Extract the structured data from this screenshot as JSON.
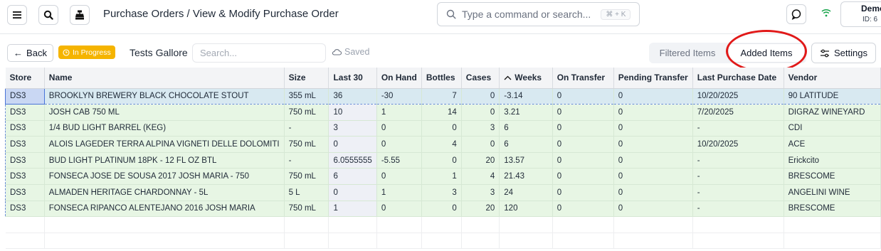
{
  "header": {
    "title": "Purchase Orders / View & Modify Purchase Order",
    "command_placeholder": "Type a command or search...",
    "command_shortcut": "⌘ + K",
    "user_name": "Demo",
    "user_id": "ID: 6"
  },
  "toolbar": {
    "back_label": "Back",
    "status": "In Progress",
    "po_name": "Tests Gallore",
    "search_placeholder": "Search...",
    "saved_label": "Saved",
    "filtered_label": "Filtered Items",
    "added_label": "Added Items",
    "settings_label": "Settings"
  },
  "colors": {
    "status_badge": "#f5b400",
    "row_green": "#e7f6e4",
    "selection_blue": "#4a74d8",
    "annotation_red": "#e11919"
  },
  "table": {
    "columns": [
      "Store",
      "Name",
      "Size",
      "Last 30",
      "On Hand",
      "Bottles",
      "Cases",
      "Weeks",
      "On Transfer",
      "Pending Transfer",
      "Last Purchase Date",
      "Vendor"
    ],
    "rows": [
      [
        "DS3",
        "BROOKLYN BREWERY BLACK CHOCOLATE STOUT",
        "355 mL",
        "36",
        "-30",
        "7",
        "0",
        "-3.14",
        "0",
        "0",
        "10/20/2025",
        "90 LATITUDE"
      ],
      [
        "DS3",
        "JOSH CAB 750 ML",
        "750 mL",
        "10",
        "1",
        "14",
        "0",
        "3.21",
        "0",
        "0",
        "7/20/2025",
        "DIGRAZ WINEYARD"
      ],
      [
        "DS3",
        "1/4 BUD LIGHT BARREL (KEG)",
        "-",
        "3",
        "0",
        "0",
        "3",
        "6",
        "0",
        "0",
        "-",
        "CDI"
      ],
      [
        "DS3",
        "ALOIS LAGEDER TERRA ALPINA VIGNETI DELLE DOLOMITI",
        "750 mL",
        "0",
        "0",
        "4",
        "0",
        "6",
        "0",
        "0",
        "10/20/2025",
        "ACE"
      ],
      [
        "DS3",
        "BUD LIGHT PLATINUM 18PK - 12 FL OZ BTL",
        "-",
        "6.0555555",
        "-5.55",
        "0",
        "20",
        "13.57",
        "0",
        "0",
        "-",
        "Erickcito"
      ],
      [
        "DS3",
        "FONSECA JOSE DE SOUSA 2017 JOSH MARIA - 750",
        "750 mL",
        "6",
        "0",
        "1",
        "4",
        "21.43",
        "0",
        "0",
        "-",
        "BRESCOME"
      ],
      [
        "DS3",
        "ALMADEN HERITAGE CHARDONNAY - 5L",
        "5 L",
        "0",
        "1",
        "3",
        "3",
        "24",
        "0",
        "0",
        "-",
        "ANGELINI WINE"
      ],
      [
        "DS3",
        "FONSECA RIPANCO ALENTEJANO 2016 JOSH MARIA",
        "750 mL",
        "1",
        "0",
        "0",
        "20",
        "120",
        "0",
        "0",
        "-",
        "BRESCOME"
      ]
    ]
  }
}
